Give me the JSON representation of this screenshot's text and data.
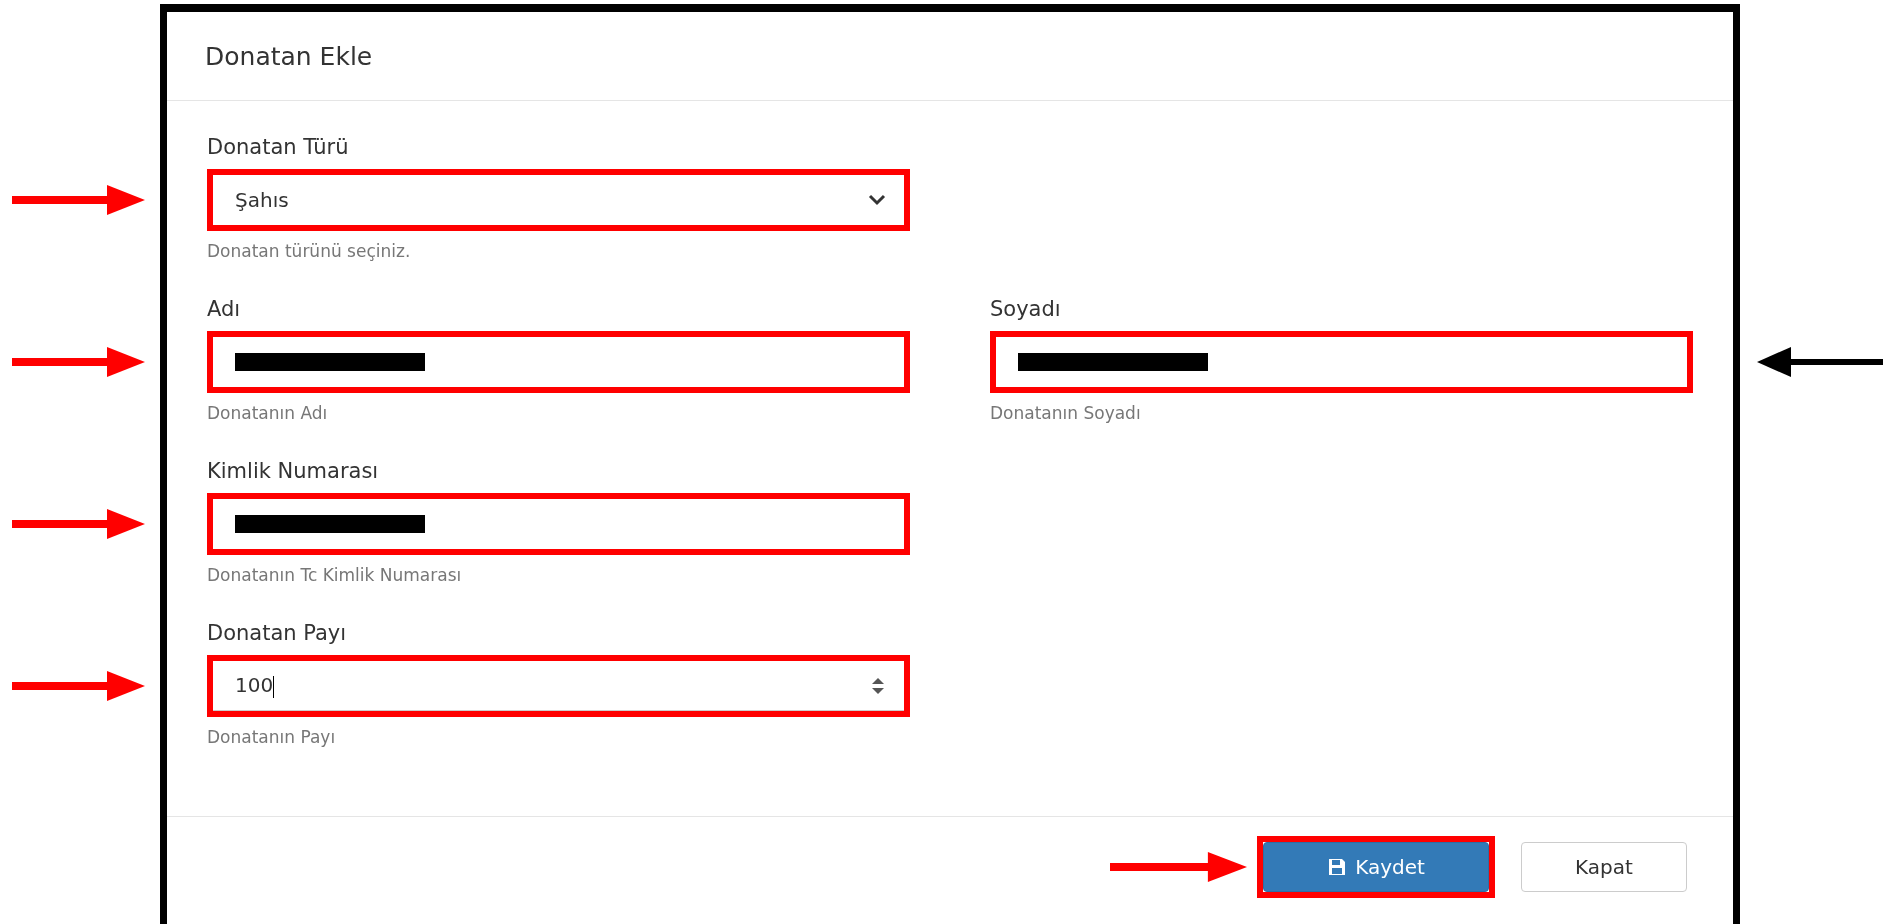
{
  "dialog": {
    "title": "Donatan Ekle"
  },
  "rows": [
    [
      {
        "kind": "select",
        "label": "Donatan Türü",
        "value": "Şahıs",
        "help": "Donatan türünü seçiniz.",
        "highlighted": true,
        "arrow": {
          "reversed": false,
          "color": "#ff0000"
        }
      }
    ],
    [
      {
        "kind": "redacted",
        "label": "Adı",
        "help": "Donatanın Adı",
        "highlighted": true,
        "arrow": {
          "reversed": false,
          "color": "#ff0000"
        }
      },
      {
        "kind": "redacted",
        "label": "Soyadı",
        "help": "Donatanın Soyadı",
        "highlighted": true,
        "arrow": {
          "reversed": true,
          "color": "#000000"
        }
      }
    ],
    [
      {
        "kind": "redacted",
        "label": "Kimlik Numarası",
        "help": "Donatanın Tc Kimlik Numarası",
        "highlighted": true,
        "arrow": {
          "reversed": false,
          "color": "#ff0000"
        }
      }
    ],
    [
      {
        "kind": "number",
        "label": "Donatan Payı",
        "value": "100",
        "help": "Donatanın Payı",
        "highlighted": true,
        "arrow": {
          "reversed": false,
          "color": "#ff0000"
        }
      }
    ]
  ],
  "buttons": [
    {
      "kind": "primary",
      "label": "Kaydet",
      "highlighted": true,
      "arrow": {
        "reversed": false,
        "color": "#ff0000"
      }
    },
    {
      "kind": "default",
      "label": "Kapat",
      "highlighted": false
    }
  ]
}
